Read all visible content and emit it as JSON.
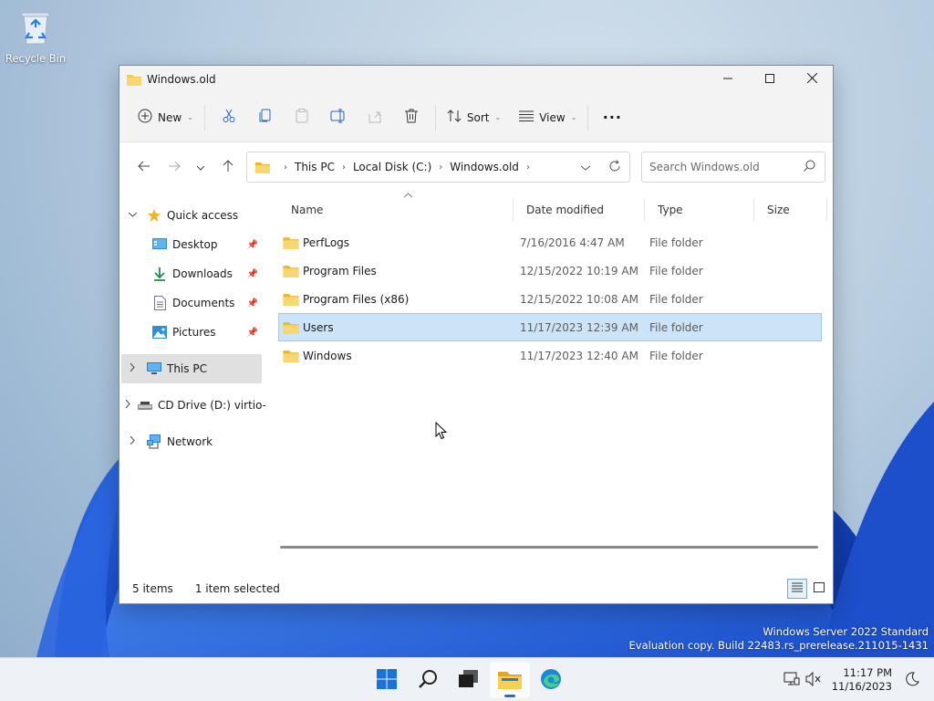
{
  "desktop": {
    "recycle_bin_label": "Recycle Bin",
    "watermark_line1": "Windows Server 2022 Standard",
    "watermark_line2": "Evaluation copy. Build 22483.rs_prerelease.211015-1431"
  },
  "window": {
    "title": "Windows.old",
    "controls": {
      "minimize": "minimize-icon",
      "maximize": "maximize-icon",
      "close": "close-icon"
    }
  },
  "toolbar": {
    "new_label": "New",
    "sort_label": "Sort",
    "view_label": "View",
    "more_label": "···",
    "icons": [
      "plus-circle-icon",
      "cut-icon",
      "copy-icon",
      "paste-icon",
      "rename-icon",
      "share-icon",
      "delete-icon",
      "sort-icon",
      "view-icon",
      "more-icon"
    ]
  },
  "address": {
    "crumbs": [
      "This PC",
      "Local Disk (C:)",
      "Windows.old"
    ],
    "search_placeholder": "Search Windows.old"
  },
  "nav": {
    "quick_access": "Quick access",
    "quick_items": [
      {
        "label": "Desktop"
      },
      {
        "label": "Downloads"
      },
      {
        "label": "Documents"
      },
      {
        "label": "Pictures"
      }
    ],
    "this_pc": "This PC",
    "cd_drive": "CD Drive (D:) virtio-win",
    "network": "Network"
  },
  "columns": {
    "name": "Name",
    "date": "Date modified",
    "type": "Type",
    "size": "Size"
  },
  "files": [
    {
      "name": "PerfLogs",
      "date": "7/16/2016 4:47 AM",
      "type": "File folder"
    },
    {
      "name": "Program Files",
      "date": "12/15/2022 10:19 AM",
      "type": "File folder"
    },
    {
      "name": "Program Files (x86)",
      "date": "12/15/2022 10:08 AM",
      "type": "File folder"
    },
    {
      "name": "Users",
      "date": "11/17/2023 12:39 AM",
      "type": "File folder",
      "selected": true
    },
    {
      "name": "Windows",
      "date": "11/17/2023 12:40 AM",
      "type": "File folder"
    }
  ],
  "status": {
    "items": "5 items",
    "selected": "1 item selected"
  },
  "taskbar": {
    "apps": [
      "start-icon",
      "search-icon",
      "task-view-icon",
      "file-explorer-icon",
      "edge-icon"
    ],
    "time": "11:17 PM",
    "date": "11/16/2023"
  },
  "colors": {
    "accent": "#1f6fc8",
    "selection": "#cce4f7",
    "folder": "#f2c94c"
  }
}
